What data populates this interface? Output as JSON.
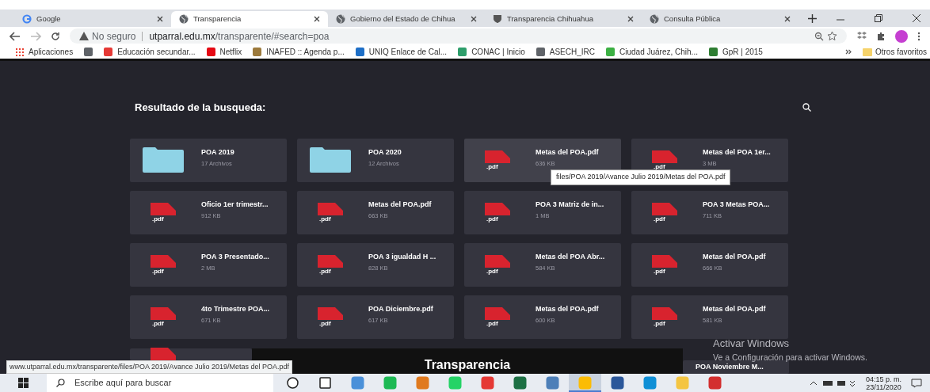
{
  "browser": {
    "tabs": [
      {
        "title": "Google",
        "selected": false
      },
      {
        "title": "Transparencia",
        "selected": true
      },
      {
        "title": "Gobierno del Estado de Chihua",
        "selected": false
      },
      {
        "title": "Transparencia Chihuahua",
        "selected": false
      },
      {
        "title": "Consulta Pública",
        "selected": false
      }
    ],
    "security": "No seguro",
    "url_host": "utparral.edu.mx",
    "url_path": "/transparente/#search=poa",
    "bookmarks": [
      {
        "kind": "labeled",
        "label": "Aplicaciones"
      },
      {
        "kind": "icon"
      },
      {
        "kind": "labeled",
        "label": "Educación secundar..."
      },
      {
        "kind": "labeled",
        "label": "Netflix"
      },
      {
        "kind": "labeled",
        "label": "INAFED :: Agenda p..."
      },
      {
        "kind": "labeled",
        "label": "UNIQ Enlace de Cal..."
      },
      {
        "kind": "labeled",
        "label": "CONAC | Inicio"
      },
      {
        "kind": "labeled",
        "label": "ASECH_IRC"
      },
      {
        "kind": "labeled",
        "label": "Ciudad Juárez, Chih..."
      },
      {
        "kind": "labeled",
        "label": "GpR | 2015"
      }
    ],
    "other_bookmarks": "Otros favoritos"
  },
  "page": {
    "heading": "Resultado de la busqueda:",
    "results": [
      {
        "kind": "folder",
        "name": "POA 2019",
        "meta": "17 Archivos",
        "hovered": false
      },
      {
        "kind": "folder",
        "name": "POA 2020",
        "meta": "12 Archivos",
        "hovered": false
      },
      {
        "kind": "pdf",
        "badge": ".pdf",
        "name": "Metas del POA.pdf",
        "meta": "636 KB",
        "hovered": true
      },
      {
        "kind": "pdf",
        "badge": ".pdf",
        "name": "Metas del POA 1er...",
        "meta": "3 MB",
        "hovered": false
      },
      {
        "kind": "pdf",
        "badge": ".pdf",
        "name": "Oficio 1er trimestr...",
        "meta": "912 KB",
        "hovered": false
      },
      {
        "kind": "pdf",
        "badge": ".pdf",
        "name": "Metas del POA.pdf",
        "meta": "663 KB",
        "hovered": false
      },
      {
        "kind": "pdf",
        "badge": ".pdf",
        "name": "POA 3 Matriz de in...",
        "meta": "1 MB",
        "hovered": false
      },
      {
        "kind": "pdf",
        "badge": ".pdf",
        "name": "POA 3 Metas POA...",
        "meta": "711 KB",
        "hovered": false
      },
      {
        "kind": "pdf",
        "badge": ".pdf",
        "name": "POA 3 Presentado...",
        "meta": "2 MB",
        "hovered": false
      },
      {
        "kind": "pdf",
        "badge": ".pdf",
        "name": "POA 3 igualdad H ...",
        "meta": "828 KB",
        "hovered": false
      },
      {
        "kind": "pdf",
        "badge": ".pdf",
        "name": "Metas del POA Abr...",
        "meta": "584 KB",
        "hovered": false
      },
      {
        "kind": "pdf",
        "badge": ".pdf",
        "name": "Metas del POA.pdf",
        "meta": "666 KB",
        "hovered": false
      },
      {
        "kind": "pdf",
        "badge": ".pdf",
        "name": "4to Trimestre POA...",
        "meta": "671 KB",
        "hovered": false
      },
      {
        "kind": "pdf",
        "badge": ".pdf",
        "name": "POA Diciembre.pdf",
        "meta": "617 KB",
        "hovered": false
      },
      {
        "kind": "pdf",
        "badge": ".pdf",
        "name": "Metas del POA.pdf",
        "meta": "600 KB",
        "hovered": false
      },
      {
        "kind": "pdf",
        "badge": ".pdf",
        "name": "Metas del POA.pdf",
        "meta": "581 KB",
        "hovered": false
      }
    ],
    "partial_row": [
      {
        "kind": "pdf"
      },
      {
        "kind": "pdf",
        "name": "POA Noviembre M..."
      }
    ],
    "tooltip": "files/POA 2019/Avance Julio 2019/Metas del POA.pdf",
    "footer_title": "Transparencia"
  },
  "status_url": "www.utparral.edu.mx/transparente/files/POA 2019/Avance Julio 2019/Metas del POA.pdf",
  "watermark_os": {
    "title": "Activar Windows",
    "subtitle": "Ve a Configuración para activar Windows."
  },
  "taskbar": {
    "search_placeholder": "Escribe aquí para buscar",
    "apps": [
      {
        "color": "#ffffff",
        "selected": false
      },
      {
        "color": "#ffffff",
        "selected": false
      },
      {
        "color": "#4a90d9",
        "selected": false
      },
      {
        "color": "#1db954",
        "selected": false
      },
      {
        "color": "#e07a1f",
        "selected": false
      },
      {
        "color": "#25d366",
        "selected": false
      },
      {
        "color": "#e53935",
        "selected": false
      },
      {
        "color": "#1d7044",
        "selected": false
      },
      {
        "color": "#4d7fb8",
        "selected": false
      },
      {
        "color": "#fbbc05",
        "selected": true
      },
      {
        "color": "#2b579a",
        "selected": false
      },
      {
        "color": "#0f8fd6",
        "selected": false
      },
      {
        "color": "#f4c542",
        "selected": false
      },
      {
        "color": "#d32f2f",
        "selected": false
      }
    ],
    "time": "04:15 p. m.",
    "date": "23/11/2020"
  }
}
